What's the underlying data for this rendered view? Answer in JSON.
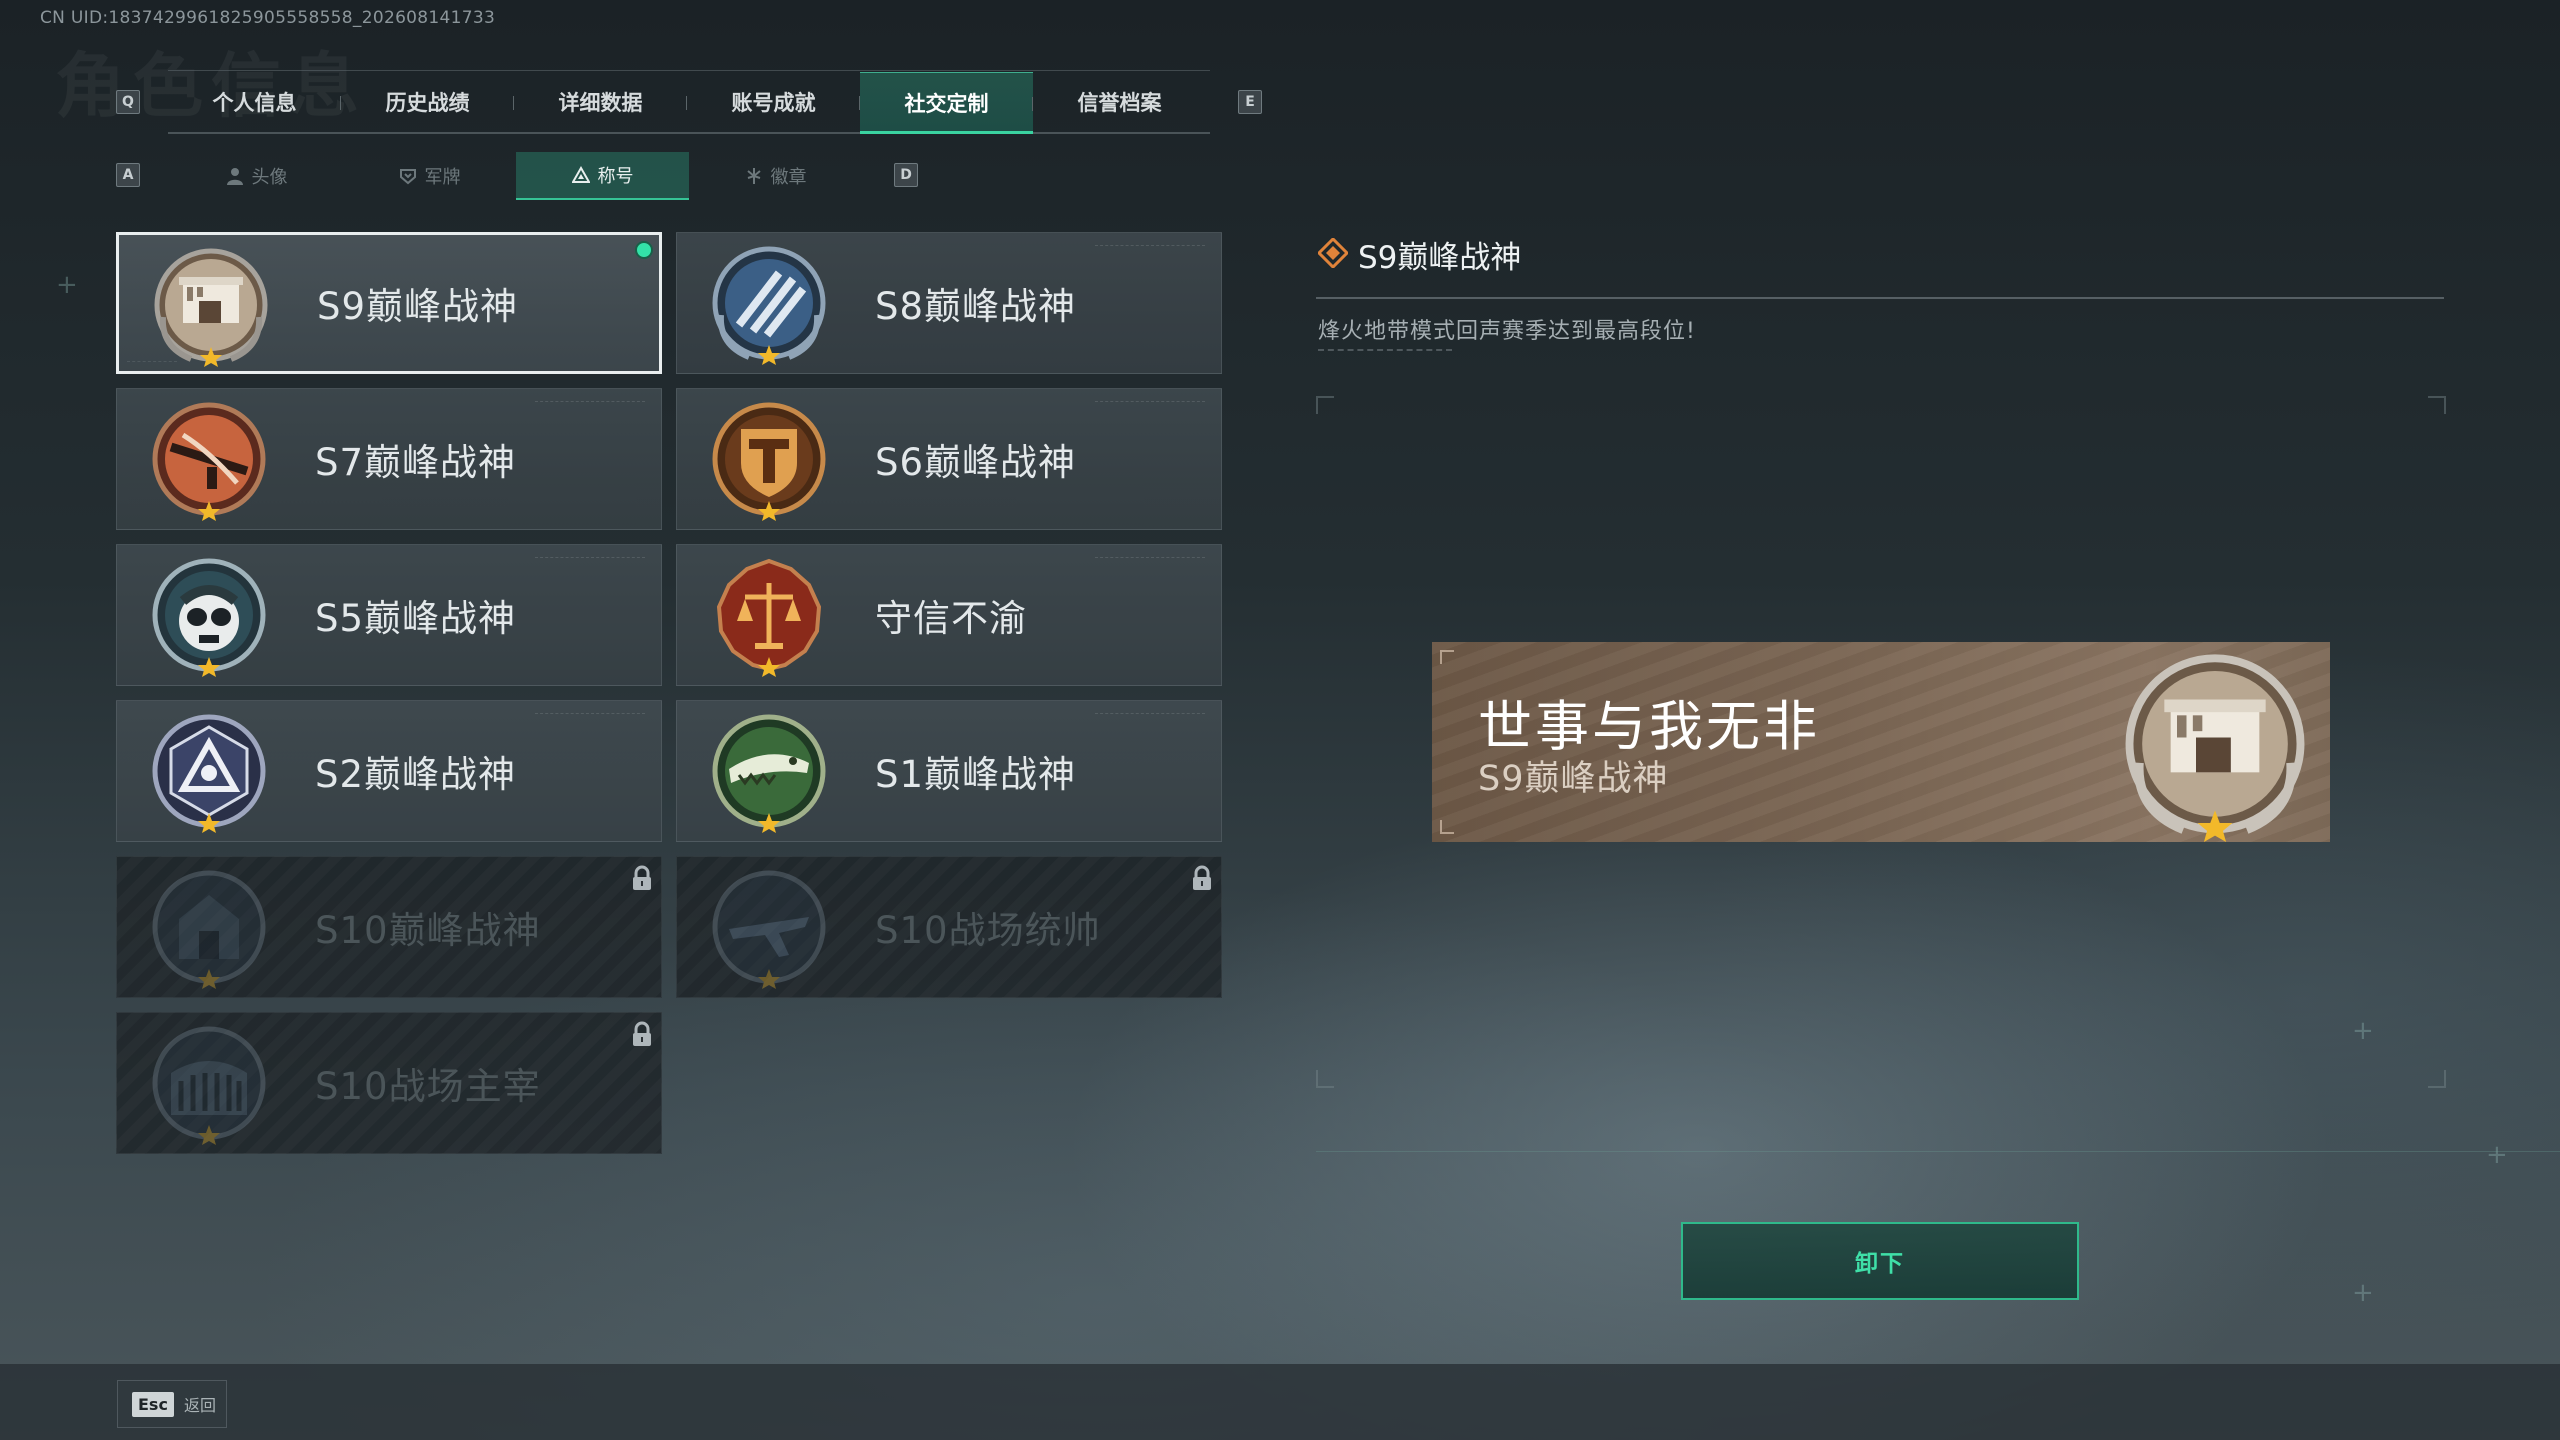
{
  "uid": "CN UID:1837429961825905558558_202608141733",
  "background_heading": "角色信息",
  "tabs": {
    "key_left": "Q",
    "key_right": "E",
    "items": [
      {
        "label": "个人信息"
      },
      {
        "label": "历史战绩"
      },
      {
        "label": "详细数据"
      },
      {
        "label": "账号成就"
      },
      {
        "label": "社交定制",
        "active": true
      },
      {
        "label": "信誉档案"
      }
    ]
  },
  "subtabs": {
    "key_left": "A",
    "key_right": "D",
    "items": [
      {
        "label": "头像",
        "icon": "person-icon"
      },
      {
        "label": "军牌",
        "icon": "dogtag-icon"
      },
      {
        "label": "称号",
        "icon": "title-triangle-icon",
        "active": true
      },
      {
        "label": "徽章",
        "icon": "emblem-icon"
      }
    ]
  },
  "titles": [
    {
      "name": "S9巅峰战神",
      "badge": "s9-fortress-badge-icon",
      "selected": true,
      "equipped": true
    },
    {
      "name": "S8巅峰战神",
      "badge": "s8-slash-badge-icon"
    },
    {
      "name": "S7巅峰战神",
      "badge": "s7-crossbow-badge-icon"
    },
    {
      "name": "S6巅峰战神",
      "badge": "s6-shield-badge-icon"
    },
    {
      "name": "S5巅峰战神",
      "badge": "s5-skull-badge-icon"
    },
    {
      "name": "守信不渝",
      "badge": "scales-badge-icon"
    },
    {
      "name": "S2巅峰战神",
      "badge": "s2-triangle-badge-icon"
    },
    {
      "name": "S1巅峰战神",
      "badge": "s1-crocodile-badge-icon"
    },
    {
      "name": "S10巅峰战神",
      "badge": "s10-building-badge-icon",
      "locked": true
    },
    {
      "name": "S10战场统帅",
      "badge": "s10-aircraft-badge-icon",
      "locked": true
    },
    {
      "name": "S10战场主宰",
      "badge": "s10-colosseum-badge-icon",
      "locked": true
    }
  ],
  "detail": {
    "title": "S9巅峰战神",
    "description": "烽火地带模式回声赛季达到最高段位!",
    "nameplate": {
      "player_name": "世事与我无非",
      "title": "S9巅峰战神"
    },
    "action_label": "卸下"
  },
  "footer": {
    "esc_key": "Esc",
    "back_label": "返回"
  },
  "colors": {
    "accent_green": "#3ad3a0",
    "nameplate_brown": "#7a6553",
    "star_gold": "#f2b92a"
  }
}
